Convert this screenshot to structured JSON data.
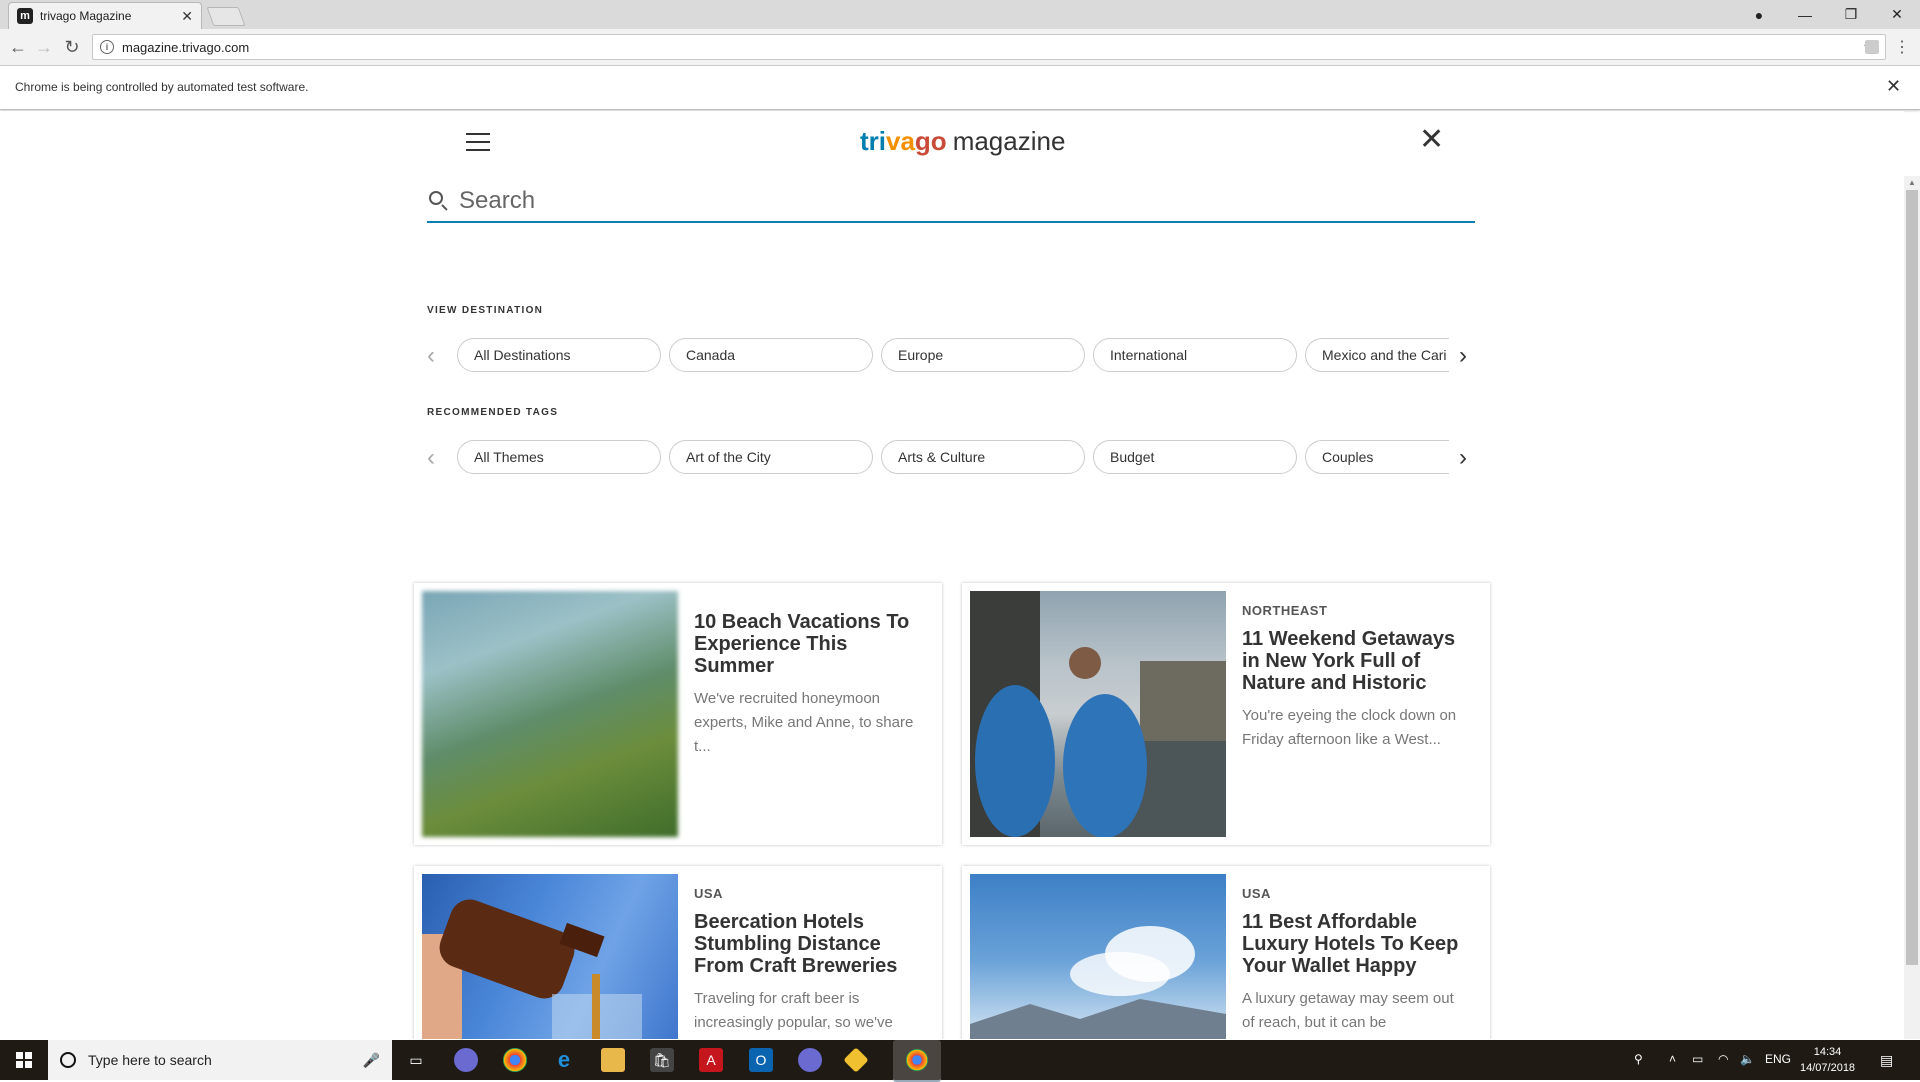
{
  "browser": {
    "tab_title": "trivago Magazine",
    "tab_favicon_letter": "m",
    "url": "magazine.trivago.com",
    "infobar_message": "Chrome is being controlled by automated test software."
  },
  "header": {
    "logo_parts": [
      "tri",
      "va",
      "go"
    ],
    "logo_word": "magazine"
  },
  "search": {
    "placeholder": "Search"
  },
  "destinations": {
    "label": "VIEW DESTINATION",
    "chips": [
      "All Destinations",
      "Canada",
      "Europe",
      "International",
      "Mexico and the Cari"
    ]
  },
  "tags": {
    "label": "RECOMMENDED TAGS",
    "chips": [
      "All Themes",
      "Art of the City",
      "Arts & Culture",
      "Budget",
      "Couples"
    ]
  },
  "articles": [
    {
      "category": "",
      "headline": "10 Beach Vacations To Experience This Summer",
      "excerpt": "We've recruited honeymoon experts, Mike and Anne, to share t..."
    },
    {
      "category": "NORTHEAST",
      "headline": "11 Weekend Getaways in New York Full of Nature and Historic",
      "excerpt": "You're eyeing the clock down on Friday afternoon like a West..."
    },
    {
      "category": "USA",
      "headline": "Beercation Hotels Stumbling Distance From Craft Breweries",
      "excerpt": "Traveling for craft beer is increasingly popular, so we've"
    },
    {
      "category": "USA",
      "headline": "11 Best Affordable Luxury Hotels To Keep Your Wallet Happy",
      "excerpt": "A luxury getaway may seem out of reach, but it can be"
    }
  ],
  "taskbar": {
    "search_placeholder": "Type here to search",
    "language": "ENG",
    "time": "14:34",
    "date": "14/07/2018"
  },
  "colors": {
    "accent": "#0a7fb5",
    "logo_blue": "#007faf",
    "logo_orange": "#f48f00",
    "logo_red": "#c94a38"
  }
}
